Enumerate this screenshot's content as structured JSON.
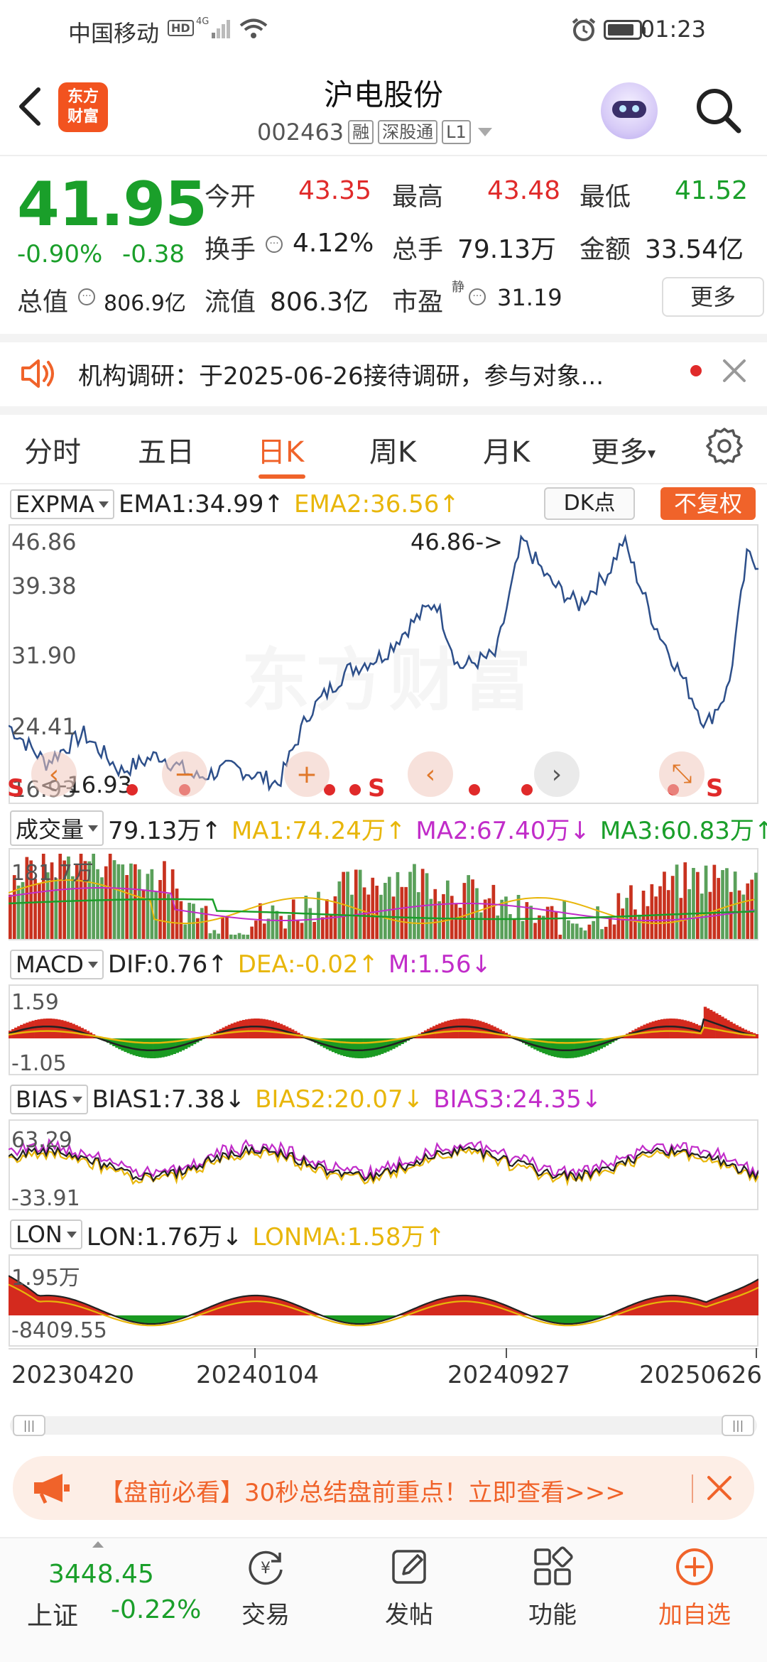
{
  "status_bar": {
    "carrier": "中国移动",
    "hd": "HD",
    "network": "4G",
    "time": "01:23"
  },
  "header": {
    "logo_text_line1": "东方",
    "logo_text_line2": "财富",
    "stock_name": "沪电股份",
    "stock_code": "002463",
    "tags": [
      "融",
      "深股通",
      "L1"
    ]
  },
  "quote": {
    "price": "41.95",
    "change_pct": "-0.90%",
    "change_abs": "-0.38",
    "open_label": "今开",
    "open": "43.35",
    "high_label": "最高",
    "high": "43.48",
    "low_label": "最低",
    "low": "41.52",
    "turnover_label": "换手",
    "turnover": "4.12%",
    "volume_label": "总手",
    "volume": "79.13万",
    "amount_label": "金额",
    "amount": "33.54亿",
    "mktcap_label": "总值",
    "mktcap": "806.9亿",
    "float_label": "流值",
    "float_cap": "806.3亿",
    "pe_label": "市盈",
    "pe_sup": "静",
    "pe": "31.19",
    "more_button": "更多"
  },
  "notice": {
    "text": "机构调研：于2025-06-26接待调研，参与对象..."
  },
  "tabs": {
    "items": [
      "分时",
      "五日",
      "日K",
      "周K",
      "月K",
      "更多"
    ],
    "active": "日K"
  },
  "kline": {
    "indicator": "EXPMA",
    "ema1": "EMA1:34.99↑",
    "ema2": "EMA2:36.56↑",
    "dk_button": "DK点",
    "fq_button": "不复权",
    "y_ticks": [
      "46.86",
      "39.38",
      "31.90",
      "24.41",
      "16.93"
    ],
    "max_annotation": "46.86->",
    "min_annotation": "<-16.93"
  },
  "volume": {
    "indicator": "成交量",
    "current": "79.13万↑",
    "ma1": "MA1:74.24万↑",
    "ma2": "MA2:67.40万↓",
    "ma3": "MA3:60.83万↑",
    "y_max": "181.7万"
  },
  "macd": {
    "indicator": "MACD",
    "dif": "DIF:0.76↑",
    "dea": "DEA:-0.02↑",
    "m": "M:1.56↓",
    "y_max": "1.59",
    "y_min": "-1.05"
  },
  "bias": {
    "indicator": "BIAS",
    "bias1": "BIAS1:7.38↓",
    "bias2": "BIAS2:20.07↓",
    "bias3": "BIAS3:24.35↓",
    "y_max": "63.29",
    "y_min": "-33.91"
  },
  "lon": {
    "indicator": "LON",
    "lon": "LON:1.76万↓",
    "lonma": "LONMA:1.58万↑",
    "y_max": "1.95万",
    "y_min": "-8409.55"
  },
  "dates": [
    "20230420",
    "20240104",
    "20240927",
    "20250626"
  ],
  "ad": {
    "text": "【盘前必看】30秒总结盘前重点！立即查看>>>"
  },
  "bottom_nav": {
    "index_price": "3448.45",
    "index_name": "上证",
    "index_change": "-0.22%",
    "items": [
      "交易",
      "发帖",
      "功能",
      "加自选"
    ]
  },
  "colors": {
    "up_red": "#e02a2a",
    "down_green": "#1a9f2a",
    "accent_orange": "#f0632a",
    "line_blue": "#2d4f8a"
  }
}
